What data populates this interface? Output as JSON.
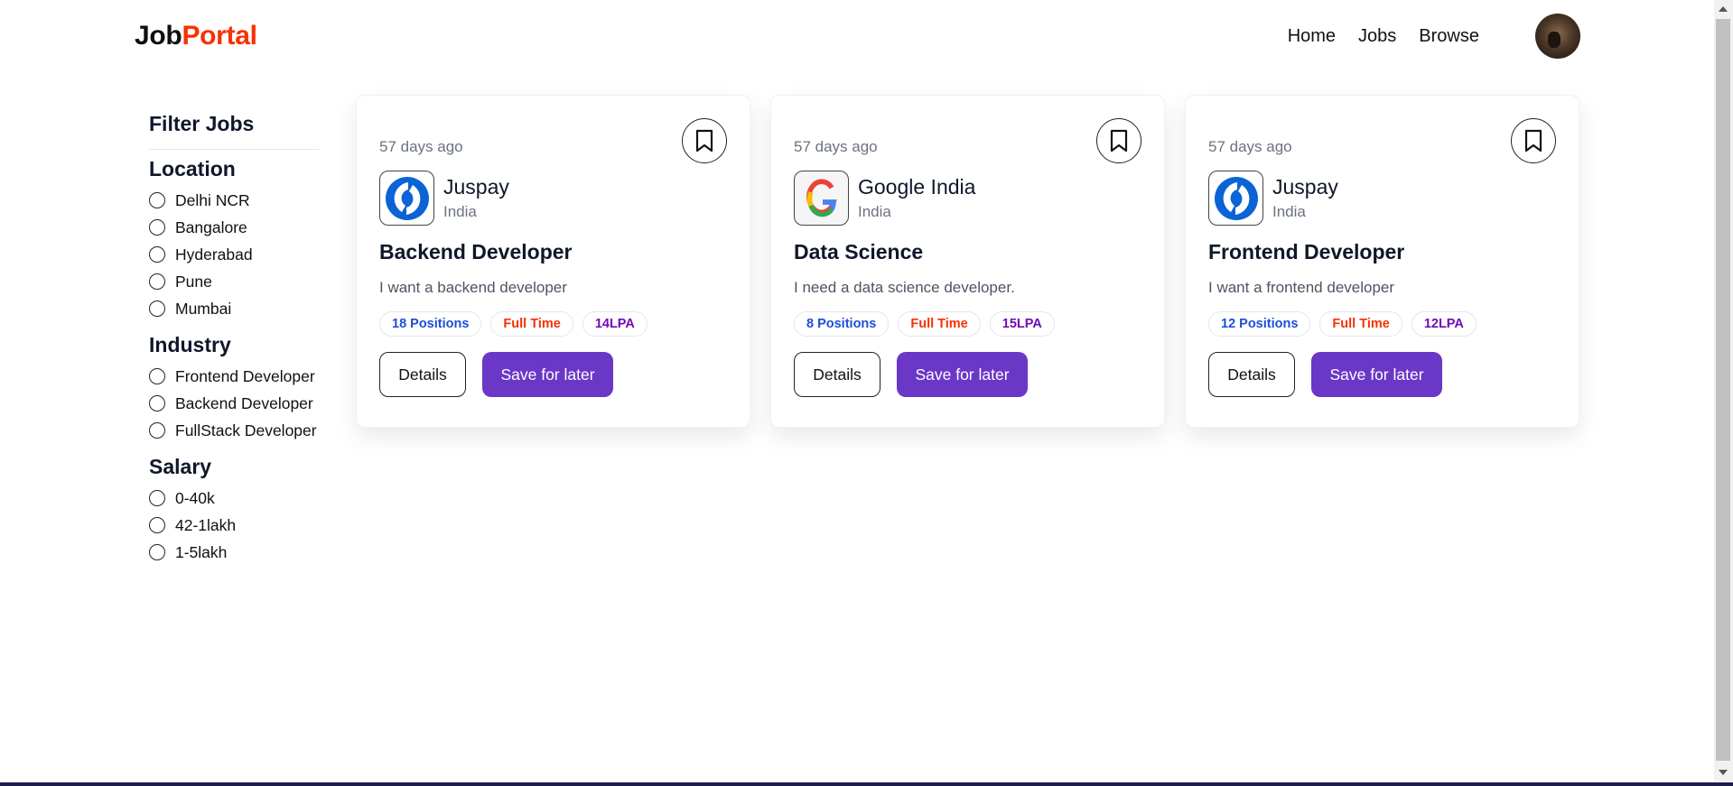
{
  "brand": {
    "part1": "Job",
    "part2": "Portal"
  },
  "nav": {
    "home": "Home",
    "jobs": "Jobs",
    "browse": "Browse"
  },
  "filters": {
    "title": "Filter Jobs",
    "groups": [
      {
        "title": "Location",
        "options": [
          "Delhi NCR",
          "Bangalore",
          "Hyderabad",
          "Pune",
          "Mumbai"
        ]
      },
      {
        "title": "Industry",
        "options": [
          "Frontend Developer",
          "Backend Developer",
          "FullStack Developer"
        ]
      },
      {
        "title": "Salary",
        "options": [
          "0-40k",
          "42-1lakh",
          "1-5lakh"
        ]
      }
    ]
  },
  "jobs": [
    {
      "posted": "57 days ago",
      "company": "Juspay",
      "country": "India",
      "logo_icon": "juspay-logo-icon",
      "title": "Backend Developer",
      "description": "I want a backend developer",
      "positions": "18 Positions",
      "job_type": "Full Time",
      "salary": "14LPA",
      "details_label": "Details",
      "save_label": "Save for later"
    },
    {
      "posted": "57 days ago",
      "company": "Google India",
      "country": "India",
      "logo_icon": "google-logo-icon",
      "title": "Data Science",
      "description": "I need a data science developer.",
      "positions": "8 Positions",
      "job_type": "Full Time",
      "salary": "15LPA",
      "details_label": "Details",
      "save_label": "Save for later"
    },
    {
      "posted": "57 days ago",
      "company": "Juspay",
      "country": "India",
      "logo_icon": "juspay-logo-icon",
      "title": "Frontend Developer",
      "description": "I want a frontend developer",
      "positions": "12 Positions",
      "job_type": "Full Time",
      "salary": "12LPA",
      "details_label": "Details",
      "save_label": "Save for later"
    }
  ],
  "colors": {
    "brand_accent": "#f83002",
    "primary_button": "#6a37c7",
    "positions_badge": "#1d4ed8",
    "type_badge": "#f83002",
    "salary_badge": "#7209b7"
  }
}
